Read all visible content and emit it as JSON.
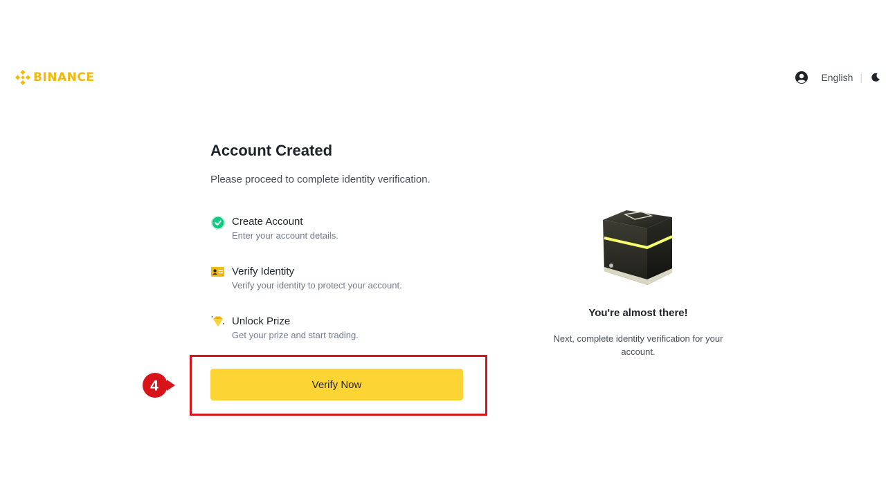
{
  "header": {
    "logo_text": "BINANCE",
    "language": "English",
    "divider": "|",
    "user_icon": "user-circle-icon",
    "theme_icon": "moon-icon"
  },
  "main": {
    "title": "Account Created",
    "subtitle": "Please proceed to complete identity verification.",
    "steps": [
      {
        "title": "Create Account",
        "desc": "Enter your account details.",
        "icon": "check-circle-icon",
        "status": "done"
      },
      {
        "title": "Verify Identity",
        "desc": "Verify your identity to protect your account.",
        "icon": "id-card-icon"
      },
      {
        "title": "Unlock Prize",
        "desc": "Get your prize and start trading.",
        "icon": "diamond-prize-icon"
      }
    ],
    "cta_label": "Verify Now"
  },
  "annotation": {
    "step_number": "4"
  },
  "side": {
    "heading": "You're almost there!",
    "text": "Next, complete identity verification for your account."
  },
  "colors": {
    "brand": "#F0B90B",
    "cta": "#FCD535",
    "highlight": "#d7141a",
    "success": "#0ecb81"
  }
}
